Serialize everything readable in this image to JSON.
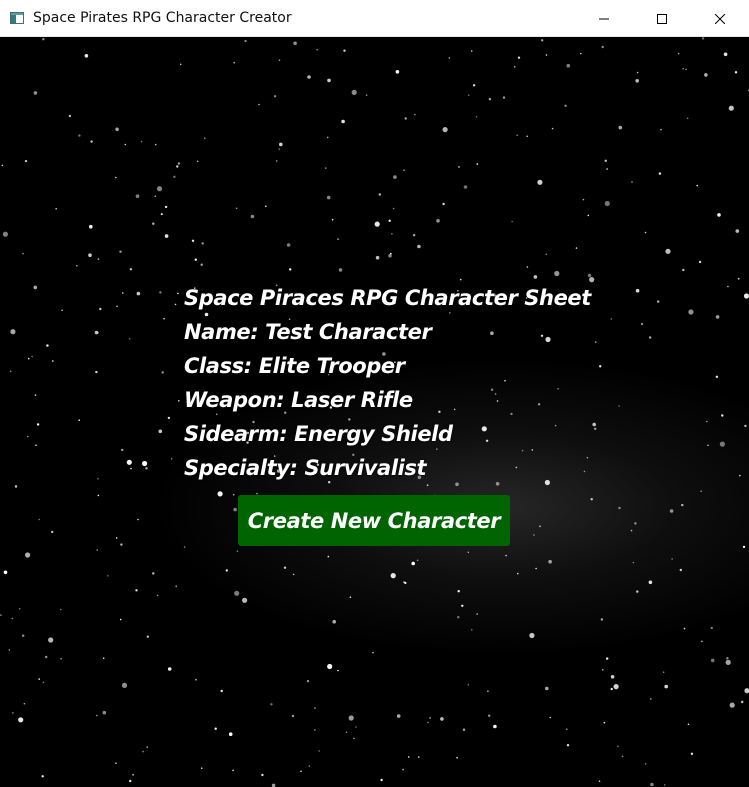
{
  "window": {
    "title": "Space Pirates RPG Character Creator",
    "controls": {
      "minimize_icon": "minimize-icon",
      "maximize_icon": "maximize-icon",
      "close_icon": "close-icon"
    }
  },
  "background": {
    "style": "starfield",
    "color": "#000000",
    "star_color": "#ffffff"
  },
  "character_sheet": {
    "heading": "Space Piraces RPG Character Sheet",
    "name": "Name: Test Character",
    "class": "Class: Elite Trooper",
    "weapon": "Weapon: Laser Rifle",
    "sidearm": "Sidearm: Energy Shield",
    "specialty": "Specialty: Survivalist"
  },
  "actions": {
    "create_label": "Create New Character",
    "create_color": "#006400"
  }
}
